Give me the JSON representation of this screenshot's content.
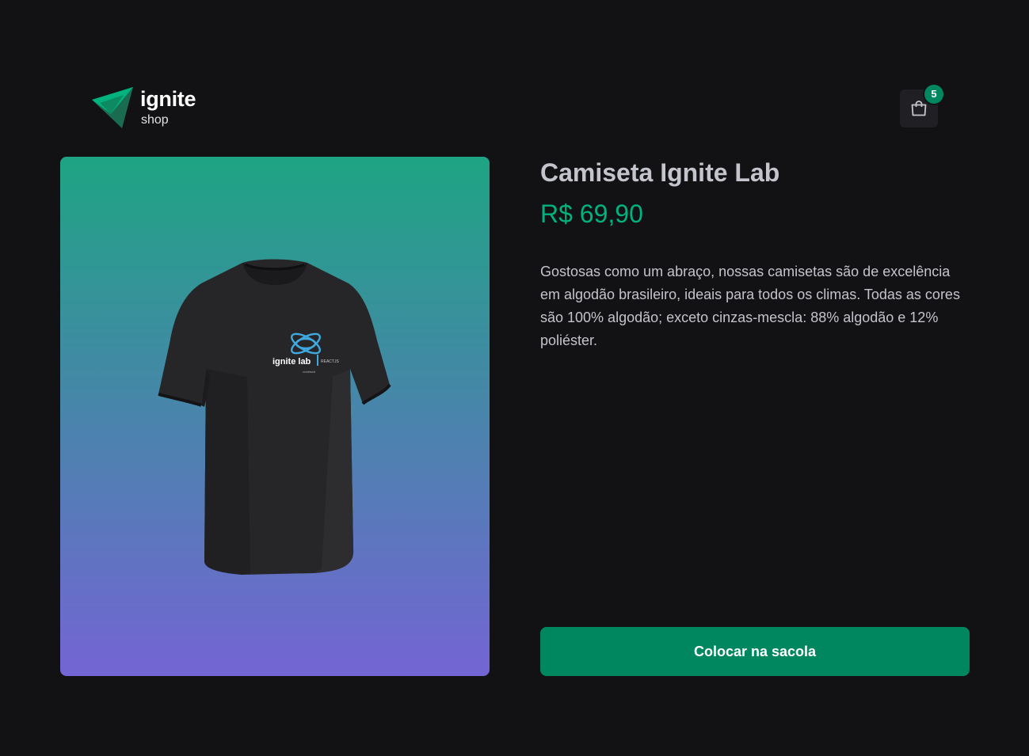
{
  "header": {
    "logo_word": "ignite",
    "logo_sub": "shop",
    "cart_count": "5"
  },
  "product": {
    "title": "Camiseta Ignite Lab",
    "price": "R$ 69,90",
    "description": "Gostosas como um abraço, nossas camisetas são de excelência em algodão brasileiro, ideais para todos os climas. Todas as cores são 100% algodão; exceto cinzas-mescla: 88% algodão e 12% poliéster.",
    "shirt_print": {
      "brand": "ignite lab",
      "tag": "REACTJS",
      "maker": "rocketseat"
    }
  },
  "actions": {
    "buy_label": "Colocar na sacola"
  },
  "colors": {
    "background": "#121214",
    "accent": "#00875f",
    "price": "#00b37e",
    "text": "#c4c4cc",
    "gradient_top": "#1ea483",
    "gradient_bottom": "#7465d4"
  },
  "icons": {
    "logo": "ignite-logo-icon",
    "cart": "shopping-bag-icon"
  }
}
